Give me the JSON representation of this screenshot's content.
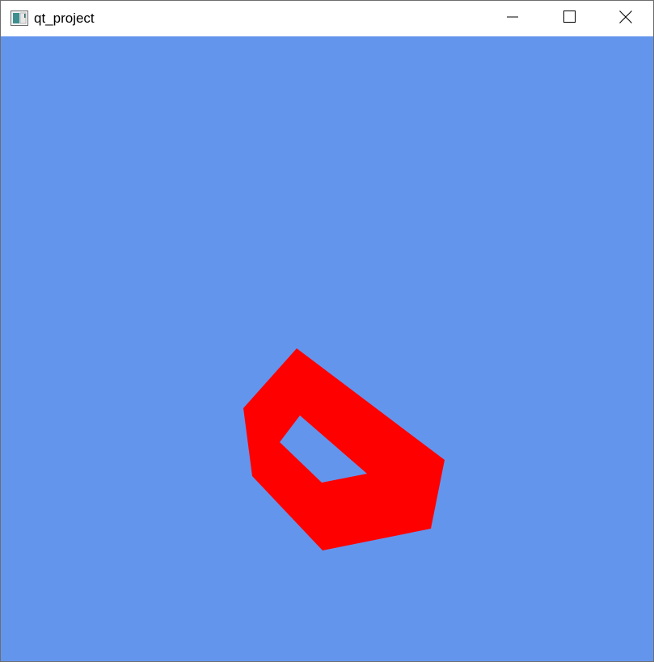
{
  "window": {
    "title": "qt_project",
    "icon": "qt-app-icon",
    "controls": {
      "minimize": "minimize-icon",
      "maximize": "maximize-icon",
      "close": "close-icon"
    }
  },
  "scene": {
    "background_color": "#6495ed",
    "shape_color": "#ff0000",
    "shape": "red-hexagonal-ring"
  }
}
